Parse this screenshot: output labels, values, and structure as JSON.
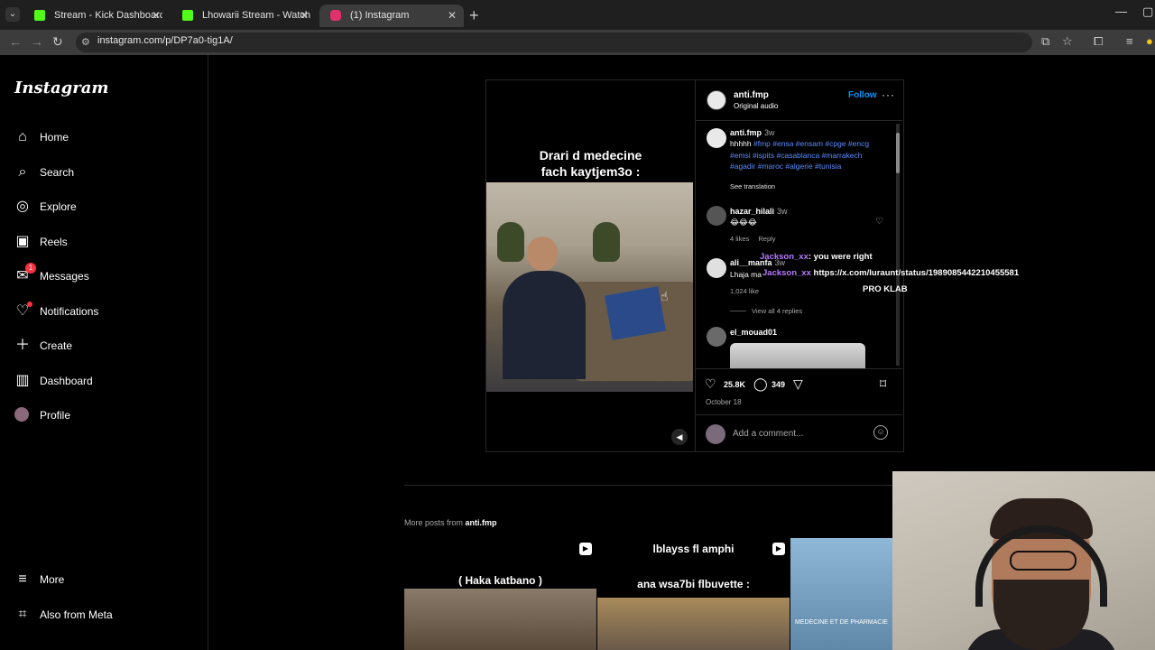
{
  "browser": {
    "tabs": [
      {
        "label": "Stream - Kick Dashboard",
        "color": "#53fc18"
      },
      {
        "label": "Lhowarii Stream - Watch Live o",
        "color": "#53fc18"
      },
      {
        "label": "(1) Instagram",
        "color": "#e1306c"
      }
    ],
    "url": "instagram.com/p/DP7a0-tig1A/"
  },
  "sidebar": {
    "logo": "Instagram",
    "items": [
      {
        "label": "Home",
        "icon": "home-icon"
      },
      {
        "label": "Search",
        "icon": "search-icon"
      },
      {
        "label": "Explore",
        "icon": "compass-icon"
      },
      {
        "label": "Reels",
        "icon": "reels-icon"
      },
      {
        "label": "Messages",
        "icon": "messenger-icon",
        "badge": "1"
      },
      {
        "label": "Notifications",
        "icon": "heart-icon"
      },
      {
        "label": "Create",
        "icon": "plus-icon"
      },
      {
        "label": "Dashboard",
        "icon": "dashboard-icon"
      },
      {
        "label": "Profile",
        "icon": "avatar"
      }
    ],
    "bottom": [
      {
        "label": "More",
        "icon": "menu-icon"
      },
      {
        "label": "Also from Meta",
        "icon": "meta-icon"
      }
    ]
  },
  "post": {
    "media_title": "Drari d medecine\nfach kaytjem3o :",
    "header": {
      "username": "anti.fmp",
      "audio": "Original audio",
      "follow": "Follow",
      "more": "···"
    },
    "caption": {
      "username": "anti.fmp",
      "time": "3w",
      "text": "hhhhh",
      "tags": "#fmp #ensa #ensam #cpge #encg #emsi #ispits #casablanca #marrakech #agadir #maroc #algerie #tunisia",
      "translation": "See translation"
    },
    "comments": [
      {
        "username": "hazar_hilali",
        "time": "3w",
        "text": "😂😂😂",
        "likes": "4 likes",
        "reply": "Reply"
      },
      {
        "username": "ali__manfa",
        "time": "3w",
        "text": "Lhaja ma",
        "likes": "1,024 like",
        "view_replies": "View all 4 replies"
      },
      {
        "username": "el_mouad01",
        "time": "",
        "text": ""
      }
    ],
    "likes_count": "25.8K",
    "comments_count": "349",
    "date": "October 18",
    "add_comment_placeholder": "Add a comment..."
  },
  "more_posts": {
    "label": "More posts from",
    "username": "anti.fmp",
    "thumbs": [
      {
        "title": "( Haka katbano )"
      },
      {
        "title_top": "lblayss fl amphi",
        "title_bottom": "ana wsa7bi flbuvette :"
      },
      {
        "title": "MEDECINE ET DE PHARMACIE"
      }
    ]
  },
  "stream_overlay": {
    "chat": [
      {
        "user": "Jackson_xx",
        "message": ": you were right"
      },
      {
        "user": "Jackson_xx",
        "message": "https://x.com/luraunt/status/1989085442210455581"
      },
      {
        "user": "",
        "message": "PRO KLAB"
      }
    ]
  }
}
